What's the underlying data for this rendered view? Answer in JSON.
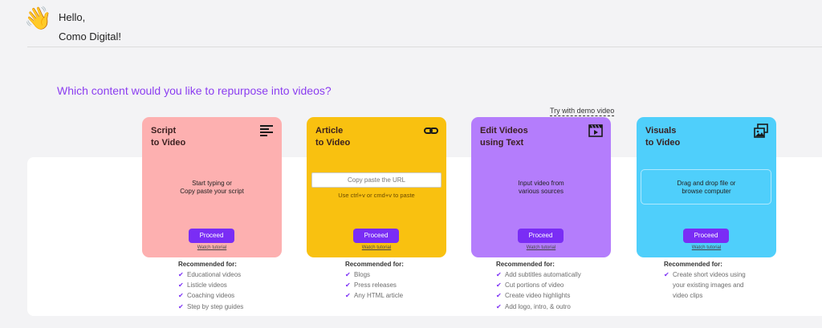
{
  "header": {
    "wave_emoji": "👋",
    "greeting": "Hello,",
    "company": "Como Digital!"
  },
  "main": {
    "question": "Which content would you like to repurpose into videos?",
    "demo_link": "Try with demo video"
  },
  "accent_color": "#7a2df5",
  "cards": [
    {
      "title": "Script\nto Video",
      "icon": "text-lines-icon",
      "color": "#fdb0b0",
      "body": "Start typing or\nCopy paste your script",
      "proceed": "Proceed",
      "watch": "Watch tutorial",
      "rec_title": "Recommended for:",
      "rec_items": [
        "Educational videos",
        "Listicle videos",
        "Coaching videos",
        "Step by step guides"
      ]
    },
    {
      "title": "Article\nto Video",
      "icon": "link-icon",
      "color": "#f9c110",
      "url_placeholder": "Copy paste the URL",
      "url_hint": "Use ctrl+v or cmd+v to paste",
      "proceed": "Proceed",
      "watch": "Watch tutorial",
      "rec_title": "Recommended for:",
      "rec_items": [
        "Blogs",
        "Press releases",
        "Any HTML article"
      ]
    },
    {
      "title": "Edit Videos\nusing Text",
      "icon": "video-clapper-icon",
      "color": "#b47dfc",
      "body": "Input video from\nvarious sources",
      "proceed": "Proceed",
      "watch": "Watch tutorial",
      "rec_title": "Recommended for:",
      "rec_items": [
        "Add subtitles automatically",
        "Cut portions of video",
        "Create video highlights",
        "Add logo, intro, & outro"
      ]
    },
    {
      "title": "Visuals\nto Video",
      "icon": "images-icon",
      "color": "#4fcffb",
      "body": "Drag and drop file or\nbrowse computer",
      "proceed": "Proceed",
      "watch": "Watch tutorial",
      "rec_title": "Recommended for:",
      "rec_items": [
        "Create short videos using",
        "your existing images and",
        "video clips"
      ]
    }
  ]
}
